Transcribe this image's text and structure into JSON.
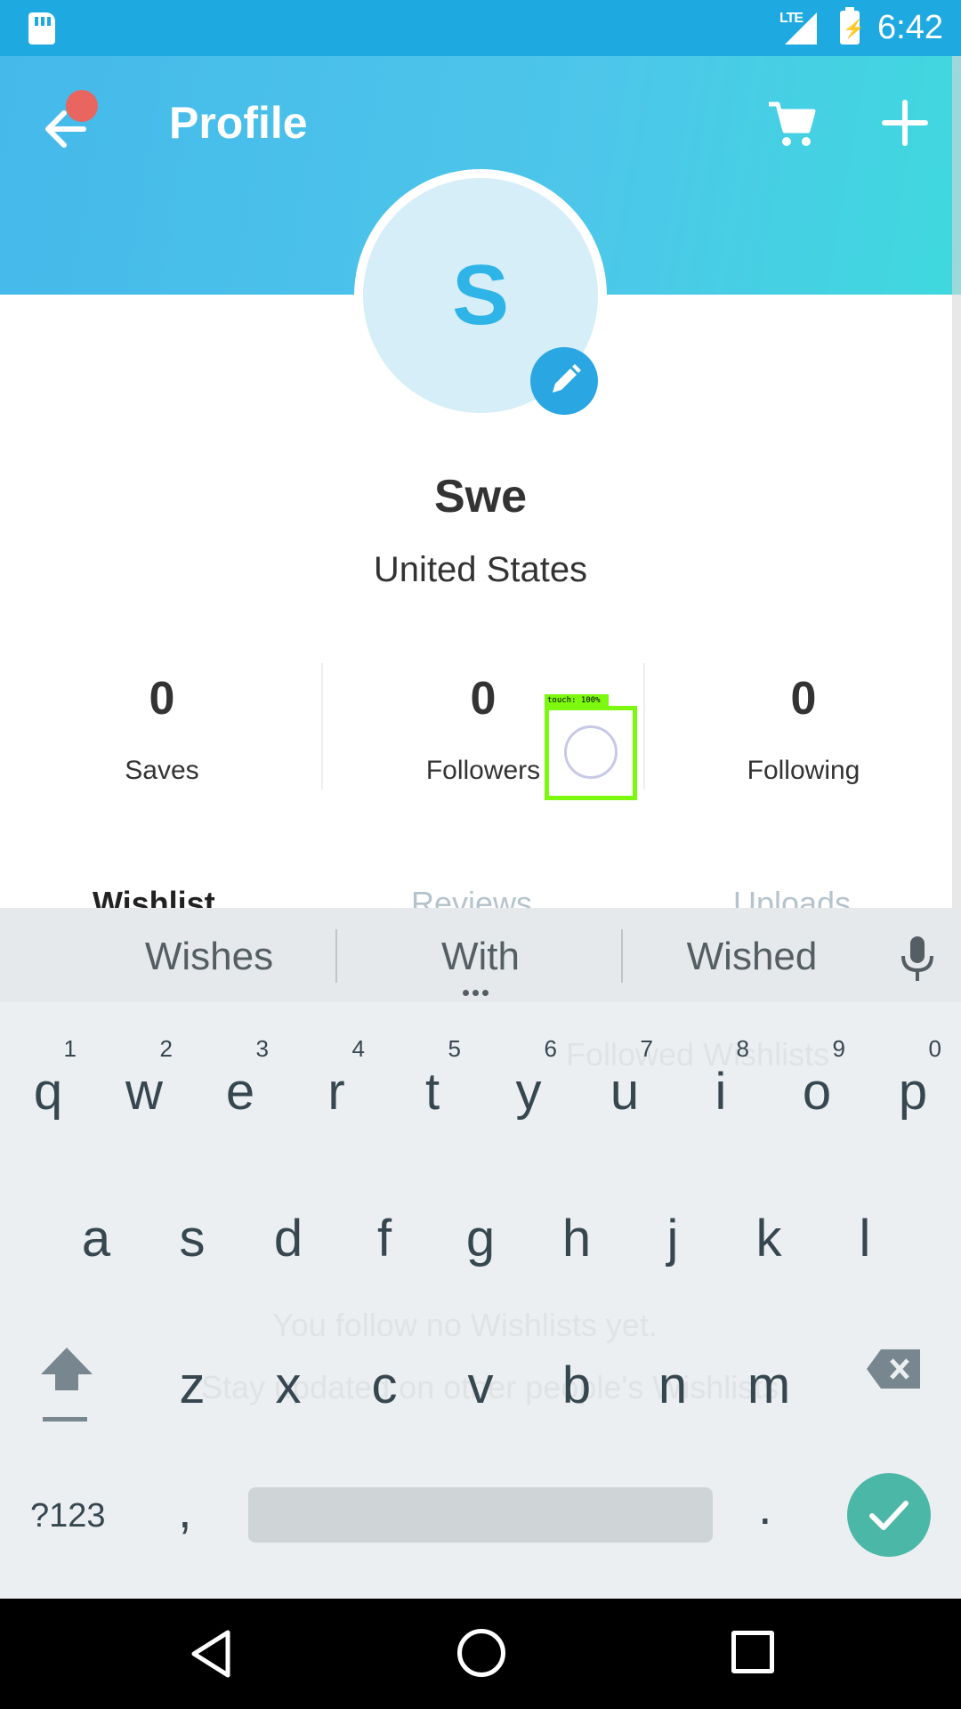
{
  "status_bar": {
    "time": "6:42",
    "network": "LTE",
    "battery_icon": "battery-charging-icon",
    "sd_icon": "sd-card-icon"
  },
  "header": {
    "title": "Profile",
    "back_icon": "back-arrow-icon",
    "cart_icon": "cart-icon",
    "add_icon": "plus-icon",
    "notification_color": "#e9655f"
  },
  "profile": {
    "avatar_letter": "S",
    "name": "Swe",
    "country": "United States"
  },
  "stats": [
    {
      "value": "0",
      "label": "Saves"
    },
    {
      "value": "0",
      "label": "Followers"
    },
    {
      "value": "0",
      "label": "Following"
    }
  ],
  "touch_overlay": {
    "label": "touch: 100%"
  },
  "tabs": [
    {
      "label": "Wishlist",
      "active": true
    },
    {
      "label": "Reviews",
      "active": false
    },
    {
      "label": "Uploads",
      "active": false
    }
  ],
  "background_content": {
    "followed_title": "Followed Wishlists",
    "empty_text": "You follow no Wishlists yet.",
    "empty_hint": "Stay updated on other people's Wishlists"
  },
  "keyboard": {
    "suggestions": [
      "Wishes",
      "With",
      "Wished"
    ],
    "row1": [
      {
        "k": "q",
        "h": "1"
      },
      {
        "k": "w",
        "h": "2"
      },
      {
        "k": "e",
        "h": "3"
      },
      {
        "k": "r",
        "h": "4"
      },
      {
        "k": "t",
        "h": "5"
      },
      {
        "k": "y",
        "h": "6"
      },
      {
        "k": "u",
        "h": "7"
      },
      {
        "k": "i",
        "h": "8"
      },
      {
        "k": "o",
        "h": "9"
      },
      {
        "k": "p",
        "h": "0"
      }
    ],
    "row2": [
      "a",
      "s",
      "d",
      "f",
      "g",
      "h",
      "j",
      "k",
      "l"
    ],
    "row3": [
      "z",
      "x",
      "c",
      "v",
      "b",
      "n",
      "m"
    ],
    "symbols_label": "?123",
    "comma": ",",
    "period": ".",
    "accent_color": "#4bb8a7"
  },
  "nav": {
    "back": "nav-back-icon",
    "home": "nav-home-icon",
    "recent": "nav-recents-icon"
  }
}
